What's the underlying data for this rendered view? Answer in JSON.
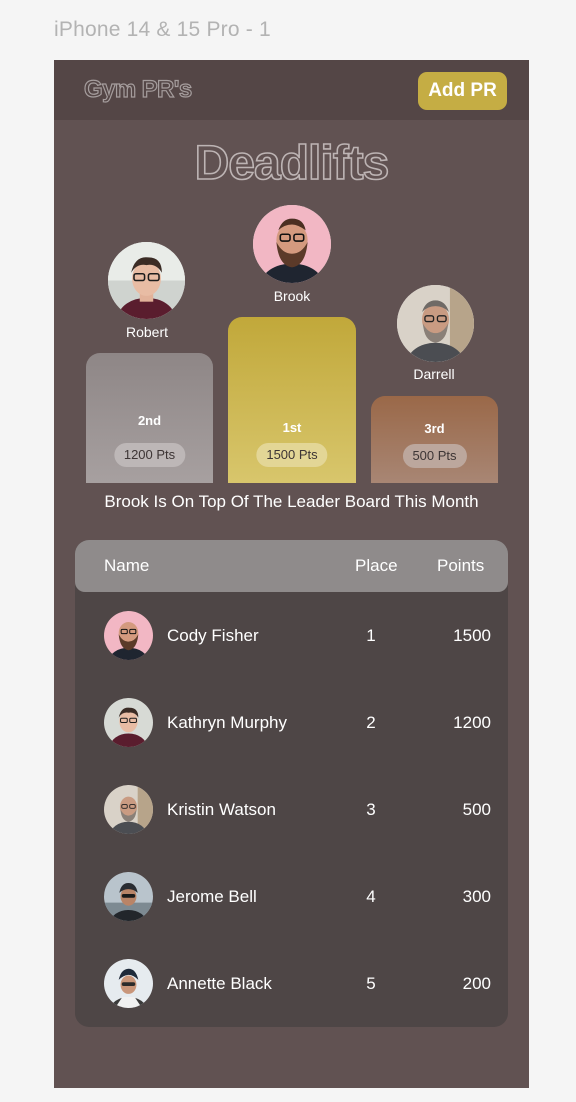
{
  "frame_label": "iPhone 14 & 15 Pro - 1",
  "header": {
    "logo": "Gym PR's",
    "add_button": "Add PR"
  },
  "page_title": "Deadlifts",
  "podium": [
    {
      "name": "Robert",
      "rank": "2nd",
      "points": "1200 Pts"
    },
    {
      "name": "Brook",
      "rank": "1st",
      "points": "1500 Pts"
    },
    {
      "name": "Darrell",
      "rank": "3rd",
      "points": "500 Pts"
    }
  ],
  "tagline": "Brook Is On Top Of The Leader Board This Month",
  "table": {
    "headers": {
      "name": "Name",
      "place": "Place",
      "points": "Points"
    },
    "rows": [
      {
        "name": "Cody Fisher",
        "place": "1",
        "points": "1500"
      },
      {
        "name": "Kathryn Murphy",
        "place": "2",
        "points": "1200"
      },
      {
        "name": "Kristin Watson",
        "place": "3",
        "points": "500"
      },
      {
        "name": "Jerome Bell",
        "place": "4",
        "points": "300"
      },
      {
        "name": "Annette Black",
        "place": "5",
        "points": "200"
      }
    ]
  },
  "colors": {
    "phone_bg": "#615252",
    "topbar_bg": "#544646",
    "accent_gold": "#c5ad44",
    "silver": "#a7a0a0",
    "bronze": "#9a6848",
    "table_bg": "#4e4646",
    "table_header_bg": "#8f8b8b"
  }
}
